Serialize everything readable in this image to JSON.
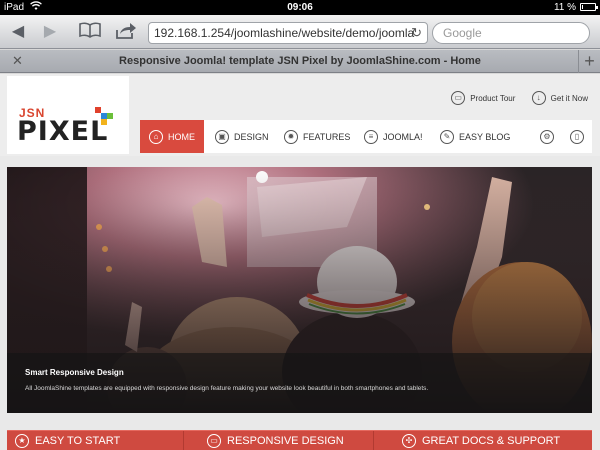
{
  "status_bar": {
    "carrier": "iPad",
    "time": "09:06",
    "battery": "11 %",
    "battery_level": 0.11
  },
  "browser": {
    "url": "192.168.1.254/joomlashine/website/demo/joomla",
    "search_placeholder": "Google",
    "tab_title": "Responsive Joomla! template JSN Pixel by JoomlaShine.com - Home",
    "icons": {
      "back": "back-arrow-icon",
      "forward": "forward-arrow-icon",
      "bookmarks": "book-icon",
      "share": "share-icon",
      "reload": "reload-icon",
      "close_tab": "close-icon",
      "new_tab": "plus-icon"
    }
  },
  "site": {
    "logo": {
      "top": "JSN",
      "bottom": "PIXEL"
    },
    "top_links": [
      {
        "label": "Product Tour",
        "icon": "monitor-icon"
      },
      {
        "label": "Get it Now",
        "icon": "download-icon"
      }
    ],
    "nav": [
      {
        "label": "HOME",
        "icon": "home-icon",
        "active": true
      },
      {
        "label": "DESIGN",
        "icon": "image-icon"
      },
      {
        "label": "FEATURES",
        "icon": "gear-icon"
      },
      {
        "label": "JOOMLA!",
        "icon": "list-icon"
      },
      {
        "label": "EASY BLOG",
        "icon": "edit-icon"
      }
    ],
    "nav_extra_icons": [
      "settings-icon",
      "mobile-icon"
    ],
    "hero": {
      "title": "Smart Responsive Design",
      "text": "All JoomlaShine templates are equipped with responsive design feature making your website look beautiful in both smartphones and tablets."
    },
    "features": [
      {
        "label": "EASY TO START",
        "icon": "star-icon"
      },
      {
        "label": "RESPONSIVE DESIGN",
        "icon": "monitor-icon"
      },
      {
        "label": "GREAT DOCS & SUPPORT",
        "icon": "lifebuoy-icon"
      }
    ]
  },
  "colors": {
    "accent": "#d94a3e",
    "logo_red": "#d9452f",
    "logo_square_red": "#e0412c",
    "logo_square_blue": "#2b87d8",
    "logo_square_green": "#6bbf3a",
    "logo_square_yellow": "#f2b31c"
  }
}
